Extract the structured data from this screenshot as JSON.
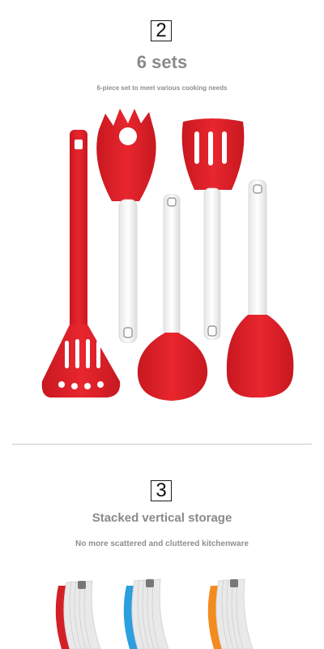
{
  "section2": {
    "number": "2",
    "title": "6 sets",
    "subtitle": "6-piece set to meet various cooking needs"
  },
  "section3": {
    "number": "3",
    "title": "Stacked vertical storage",
    "subtitle": "No more scattered and cluttered kitchenware"
  },
  "colors": {
    "utensil_red": "#e1222b",
    "handle_white": "#f4f4f4",
    "text_gray": "#8a8a8a",
    "divider": "#c9c9c9",
    "stack_red": "#d32027",
    "stack_blue": "#2b9fe0",
    "stack_orange": "#f28c1e"
  },
  "images": {
    "utensils": "six-piece-utensil-set",
    "storage": "stacked-utensil-storage"
  }
}
